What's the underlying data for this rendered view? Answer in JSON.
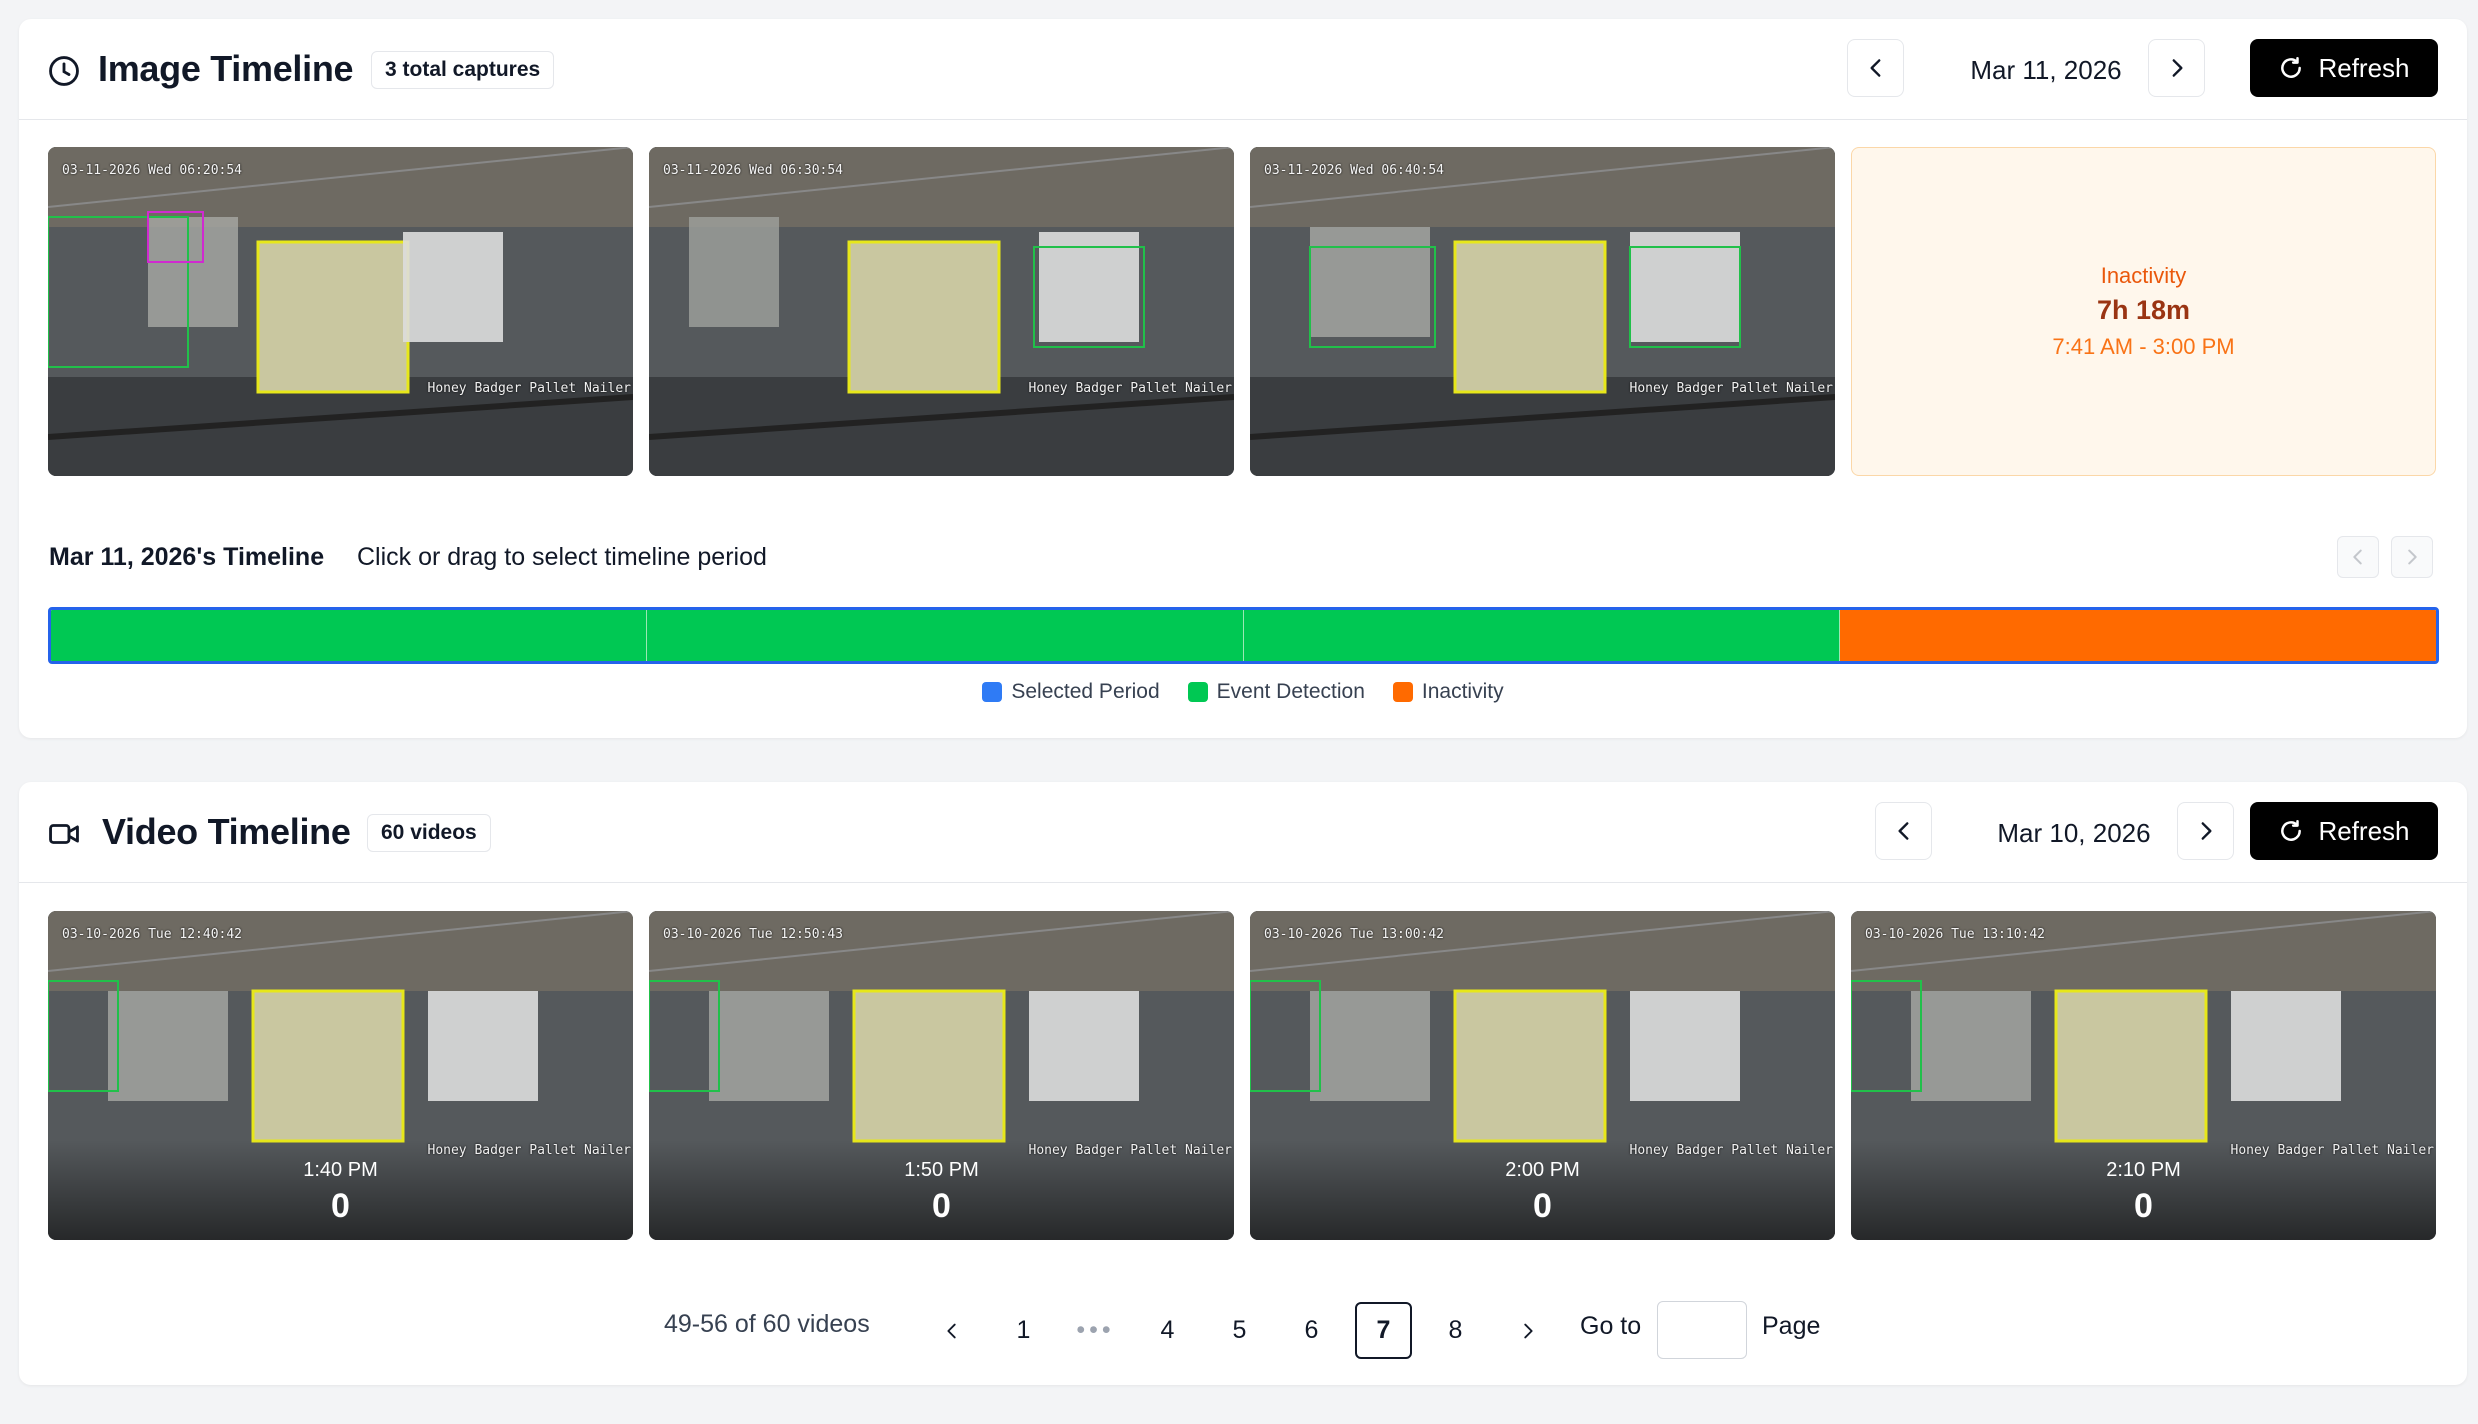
{
  "image_timeline": {
    "title": "Image Timeline",
    "badge": "3 total captures",
    "date": "Mar 11, 2026",
    "refresh_label": "Refresh",
    "captures": [
      {
        "timestamp": "03-11-2026 Wed 06:20:54",
        "brand": "Honey Badger Pallet Nailer"
      },
      {
        "timestamp": "03-11-2026 Wed 06:30:54",
        "brand": "Honey Badger Pallet Nailer"
      },
      {
        "timestamp": "03-11-2026 Wed 06:40:54",
        "brand": "Honey Badger Pallet Nailer"
      }
    ],
    "inactivity": {
      "label": "Inactivity",
      "duration": "7h 18m",
      "range": "7:41 AM - 3:00 PM"
    },
    "timeline": {
      "title": "Mar 11, 2026's Timeline",
      "hint": "Click or drag to select timeline period",
      "segments": [
        {
          "type": "event",
          "fraction": 0.25
        },
        {
          "type": "event",
          "fraction": 0.25
        },
        {
          "type": "event",
          "fraction": 0.25
        },
        {
          "type": "inactivity",
          "fraction": 0.25
        }
      ]
    },
    "legend": [
      {
        "label": "Selected Period",
        "color": "#2f7bf5"
      },
      {
        "label": "Event Detection",
        "color": "#00c853"
      },
      {
        "label": "Inactivity",
        "color": "#ff6a00"
      }
    ]
  },
  "video_timeline": {
    "title": "Video Timeline",
    "badge": "60 videos",
    "date": "Mar 10, 2026",
    "refresh_label": "Refresh",
    "videos": [
      {
        "timestamp": "03-10-2026 Tue 12:40:42",
        "time": "1:40 PM",
        "count": "0",
        "brand": "Honey Badger Pallet Nailer"
      },
      {
        "timestamp": "03-10-2026 Tue 12:50:43",
        "time": "1:50 PM",
        "count": "0",
        "brand": "Honey Badger Pallet Nailer"
      },
      {
        "timestamp": "03-10-2026 Tue 13:00:42",
        "time": "2:00 PM",
        "count": "0",
        "brand": "Honey Badger Pallet Nailer"
      },
      {
        "timestamp": "03-10-2026 Tue 13:10:42",
        "time": "2:10 PM",
        "count": "0",
        "brand": "Honey Badger Pallet Nailer"
      }
    ],
    "pagination": {
      "summary": "49-56 of 60 videos",
      "pages": [
        "1",
        "•••",
        "4",
        "5",
        "6",
        "7",
        "8"
      ],
      "current": "7",
      "goto_label": "Go to",
      "goto_value": "",
      "page_word": "Page"
    }
  }
}
